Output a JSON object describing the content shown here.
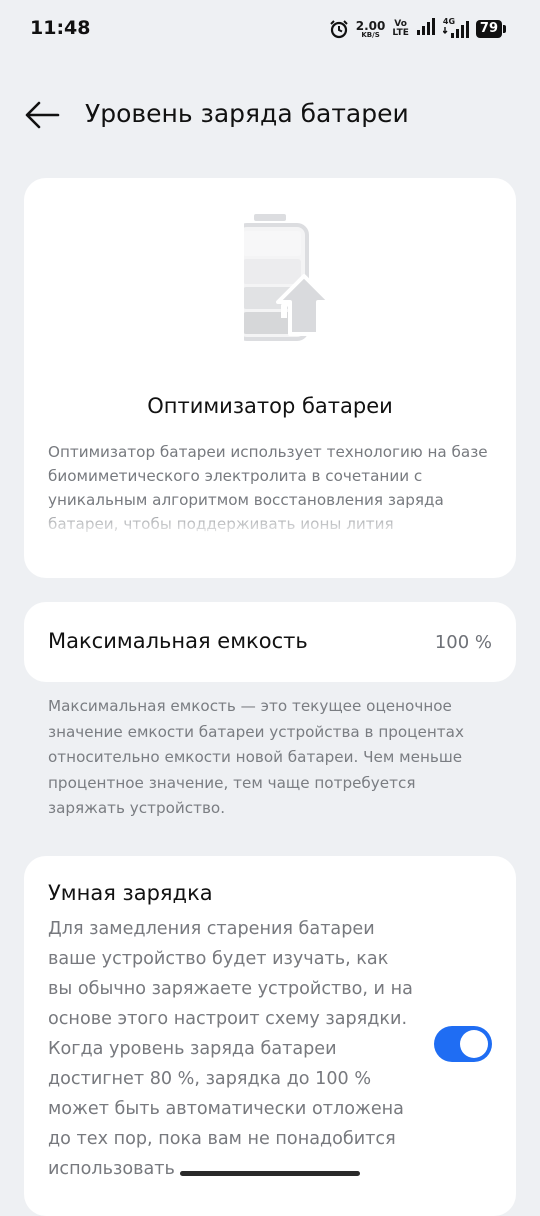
{
  "status_bar": {
    "time": "11:48",
    "net_speed_value": "2.00",
    "net_speed_unit": "KB/S",
    "volte_top": "Vo",
    "volte_bottom": "LTE",
    "network_type": "4G",
    "battery_level": "79"
  },
  "header": {
    "title": "Уровень заряда батареи"
  },
  "optimizer": {
    "title": "Оптимизатор батареи",
    "description": "Оптимизатор батареи использует технологию на базе биомиметического электролита в сочетании с уникальным алгоритмом восстановления заряда батареи, чтобы поддерживать ионы лития"
  },
  "max_capacity": {
    "label": "Максимальная емкость",
    "value": "100 %",
    "description": "Максимальная емкость — это текущее оценочное значение емкости батареи устройства в процентах относительно емкости новой батареи. Чем меньше процентное значение, тем чаще потребуется заряжать устройство."
  },
  "smart_charging": {
    "title": "Умная зарядка",
    "description": "Для замедления старения батареи ваше устройство будет изучать, как вы обычно заряжаете устройство, и на основе этого настроит схему зарядки. Когда уровень заряда батареи достигнет 80 %, зарядка до 100 % может быть автоматически отложена до тех пор, пока вам не понадобится использовать",
    "enabled": true
  },
  "colors": {
    "accent": "#1f6df3",
    "background": "#eef0f3",
    "card": "#ffffff"
  }
}
